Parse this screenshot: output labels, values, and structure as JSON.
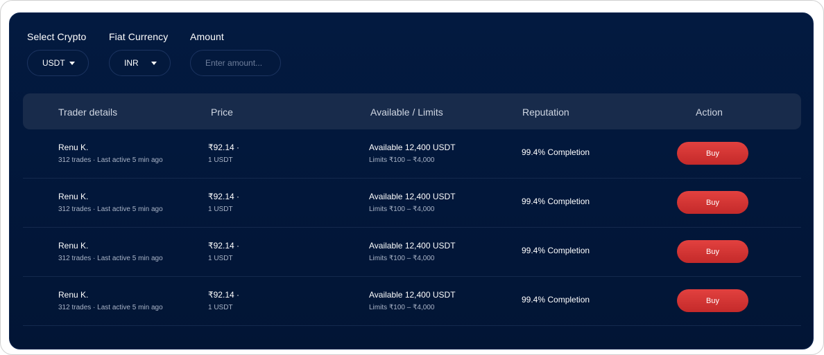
{
  "filters": {
    "crypto_label": "Select Crypto",
    "crypto_value": "USDT",
    "fiat_label": "Fiat Currency",
    "fiat_value": "INR",
    "amount_label": "Amount",
    "amount_placeholder": "Enter amount..."
  },
  "table": {
    "headers": [
      "Trader details",
      "Price",
      "Available / Limits",
      "Reputation",
      "Action"
    ],
    "rows": [
      {
        "name": "Renu K.",
        "meta": "312 trades · Last active 5 min ago",
        "price": "₹92.14 ·",
        "unit": "1 USDT",
        "available": "Available 12,400 USDT",
        "limits": "Limits ₹100 – ₹4,000",
        "reputation": "99.4% Completion",
        "action": "Buy"
      },
      {
        "name": "Renu K.",
        "meta": "312 trades · Last active 5 min ago",
        "price": "₹92.14 ·",
        "unit": "1 USDT",
        "available": "Available 12,400 USDT",
        "limits": "Limits ₹100 – ₹4,000",
        "reputation": "99.4% Completion",
        "action": "Buy"
      },
      {
        "name": "Renu K.",
        "meta": "312 trades · Last active 5 min ago",
        "price": "₹92.14 ·",
        "unit": "1 USDT",
        "available": "Available 12,400 USDT",
        "limits": "Limits ₹100 – ₹4,000",
        "reputation": "99.4% Completion",
        "action": "Buy"
      },
      {
        "name": "Renu K.",
        "meta": "312 trades · Last active 5 min ago",
        "price": "₹92.14 ·",
        "unit": "1 USDT",
        "available": "Available 12,400 USDT",
        "limits": "Limits ₹100 – ₹4,000",
        "reputation": "99.4% Completion",
        "action": "Buy"
      }
    ]
  },
  "colors": {
    "panel_bg": "#031a40",
    "header_bg": "#182b4b",
    "buy_button": "#d8363a"
  },
  "icons": {
    "dropdown": "chevron-down-icon"
  }
}
